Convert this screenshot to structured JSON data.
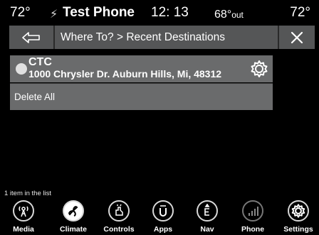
{
  "status": {
    "temp_left": "72°",
    "device": "Test Phone",
    "clock": "12: 13",
    "outside_temp": "68°",
    "outside_suffix": "out",
    "temp_right": "72°"
  },
  "header": {
    "breadcrumb": "Where To? > Recent Destinations"
  },
  "destinations": [
    {
      "name": "CTC",
      "address": "1000 Chrysler Dr. Auburn Hills, Mi, 48312"
    }
  ],
  "actions": {
    "delete_all": "Delete All"
  },
  "list_count": "1 item in the list",
  "nav": [
    {
      "label": "Media",
      "icon": "media-icon"
    },
    {
      "label": "Climate",
      "icon": "climate-icon"
    },
    {
      "label": "Controls",
      "icon": "controls-icon"
    },
    {
      "label": "Apps",
      "icon": "apps-icon"
    },
    {
      "label": "Nav",
      "icon": "nav-icon"
    },
    {
      "label": "Phone",
      "icon": "phone-icon"
    },
    {
      "label": "Settings",
      "icon": "settings-icon"
    }
  ]
}
